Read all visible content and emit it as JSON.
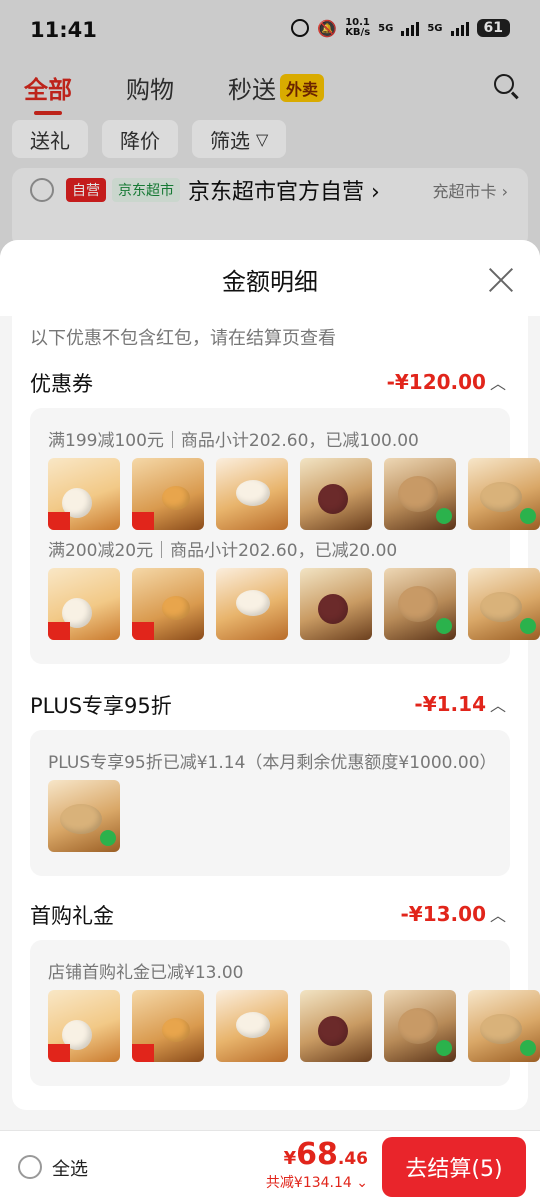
{
  "status_bar": {
    "time": "11:41",
    "net_speed": "10.1\nKB/s",
    "sig1": "5G",
    "sig2": "5G",
    "battery": "61"
  },
  "top_tabs": [
    {
      "label": "全部",
      "active": true
    },
    {
      "label": "购物",
      "active": false
    },
    {
      "label": "秒送",
      "active": false,
      "badge": "外卖"
    }
  ],
  "filter_chips": [
    "送礼",
    "降价",
    "筛选"
  ],
  "store": {
    "tag_self": "自营",
    "tag_market": "京东超市",
    "name": "京东超市官方自营 ›",
    "card": "充超市卡 ›"
  },
  "sheet": {
    "title": "金额明细",
    "note": "以下优惠不包含红包，请在结算页查看",
    "sections": [
      {
        "title": "优惠券",
        "amount": "-¥120.00",
        "lines": [
          "满199减100元｜商品小计202.60，已减100.00",
          "满200减20元｜商品小计202.60，已减20.00"
        ],
        "thumbs": [
          6,
          6
        ]
      },
      {
        "title": "PLUS专享95折",
        "amount": "-¥1.14",
        "lines": [
          "PLUS专享95折已减¥1.14（本月剩余优惠额度¥1000.00）"
        ],
        "thumbs": [
          1
        ]
      },
      {
        "title": "首购礼金",
        "amount": "-¥13.00",
        "lines": [
          "店铺首购礼金已减¥13.00"
        ],
        "thumbs": [
          6
        ]
      }
    ]
  },
  "bottom_bar": {
    "select_all": "全选",
    "currency": "¥",
    "total_int": "68",
    "total_dec": ".46",
    "saved": "共减¥134.14 ⌄",
    "checkout": "去结算(5)"
  },
  "colors": {
    "accent": "#e1251b",
    "checkout_bg": "#e9252b"
  }
}
